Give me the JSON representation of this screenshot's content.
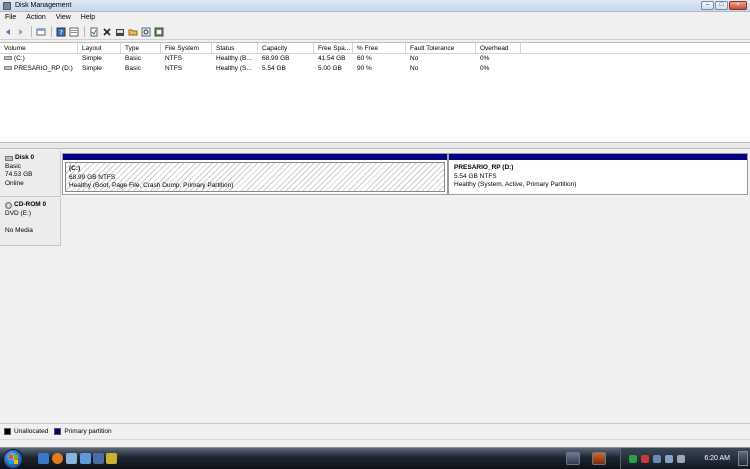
{
  "window": {
    "title": "Disk Management"
  },
  "menu": [
    "File",
    "Action",
    "View",
    "Help"
  ],
  "toolbar": {
    "buttons": [
      "back-icon",
      "forward-icon",
      "up-icon",
      "help-icon",
      "properties-icon",
      "refresh-icon",
      "delete-icon",
      "check-icon",
      "open-icon",
      "search-icon",
      "properties2-icon"
    ]
  },
  "volume_list": {
    "columns": [
      "Volume",
      "Layout",
      "Type",
      "File System",
      "Status",
      "Capacity",
      "Free Spa...",
      "% Free",
      "Fault Tolerance",
      "Overhead"
    ],
    "rows": [
      [
        "(C:)",
        "Simple",
        "Basic",
        "NTFS",
        "Healthy (B...",
        "68.99 GB",
        "41.54 GB",
        "60 %",
        "No",
        "0%"
      ],
      [
        "PRESARIO_RP (D:)",
        "Simple",
        "Basic",
        "NTFS",
        "Healthy (S...",
        "5.54 GB",
        "5.00 GB",
        "90 %",
        "No",
        "0%"
      ]
    ]
  },
  "disks": [
    {
      "name": "Disk 0",
      "type": "Basic",
      "size": "74.53 GB",
      "status": "Online",
      "partitions": [
        {
          "name": "(C:)",
          "size": "68.99 GB NTFS",
          "status": "Healthy (Boot, Page File, Crash Dump, Primary Partition)"
        },
        {
          "name": "PRESARIO_RP  (D:)",
          "size": "5.54 GB NTFS",
          "status": "Healthy (System, Active, Primary Partition)"
        }
      ]
    },
    {
      "name": "CD-ROM 0",
      "type": "DVD (E:)",
      "size": "",
      "status": "No Media"
    }
  ],
  "legend": [
    {
      "label": "Unallocated",
      "color": "#000000"
    },
    {
      "label": "Primary partition",
      "color": "#000080"
    }
  ],
  "taskbar": {
    "clock": "6:20 AM"
  },
  "colors": {
    "partition_bar": "#000080",
    "accent": "#2f73c4"
  }
}
